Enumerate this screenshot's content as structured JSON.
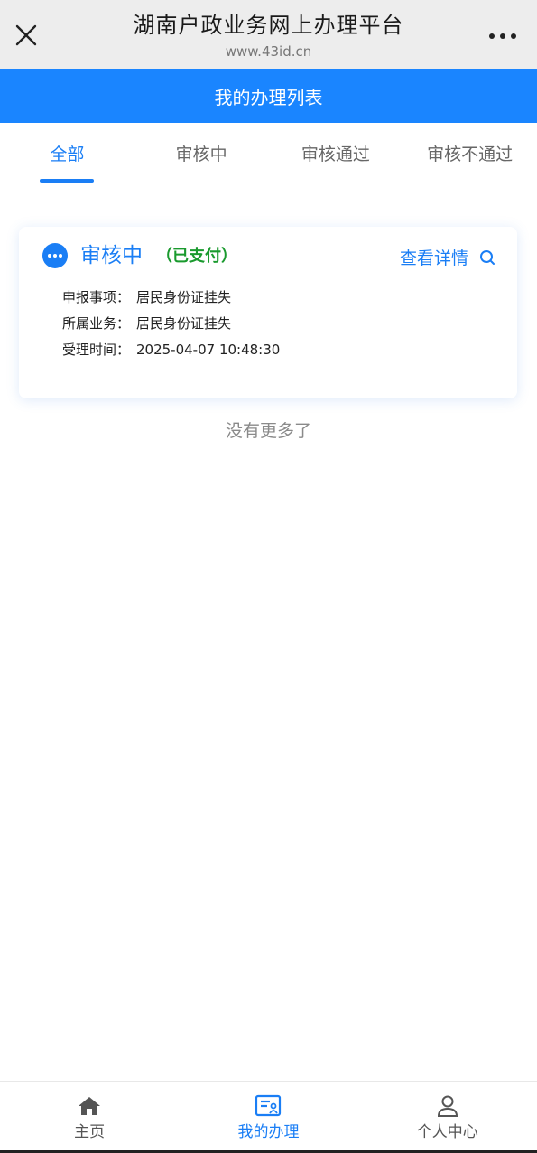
{
  "browser": {
    "title": "湖南户政业务网上办理平台",
    "url": "www.43id.cn"
  },
  "header": {
    "title": "我的办理列表"
  },
  "tabs": [
    {
      "label": "全部",
      "active": true
    },
    {
      "label": "审核中",
      "active": false
    },
    {
      "label": "审核通过",
      "active": false
    },
    {
      "label": "审核不通过",
      "active": false
    }
  ],
  "card": {
    "status": "审核中",
    "paid": "（已支付）",
    "detail_label": "查看详情",
    "rows": [
      {
        "label": "申报事项：",
        "value": "居民身份证挂失"
      },
      {
        "label": "所属业务：",
        "value": "居民身份证挂失"
      },
      {
        "label": "受理时间：",
        "value": "2025-04-07 10:48:30"
      }
    ]
  },
  "list_end_text": "没有更多了",
  "bottom_nav": [
    {
      "label": "主页",
      "icon": "home-icon",
      "active": false
    },
    {
      "label": "我的办理",
      "icon": "my-handling-icon",
      "active": true
    },
    {
      "label": "个人中心",
      "icon": "user-icon",
      "active": false
    }
  ],
  "colors": {
    "accent": "#1a85ff",
    "paid_green": "#1a9a2e",
    "muted": "#8a8a8a"
  }
}
